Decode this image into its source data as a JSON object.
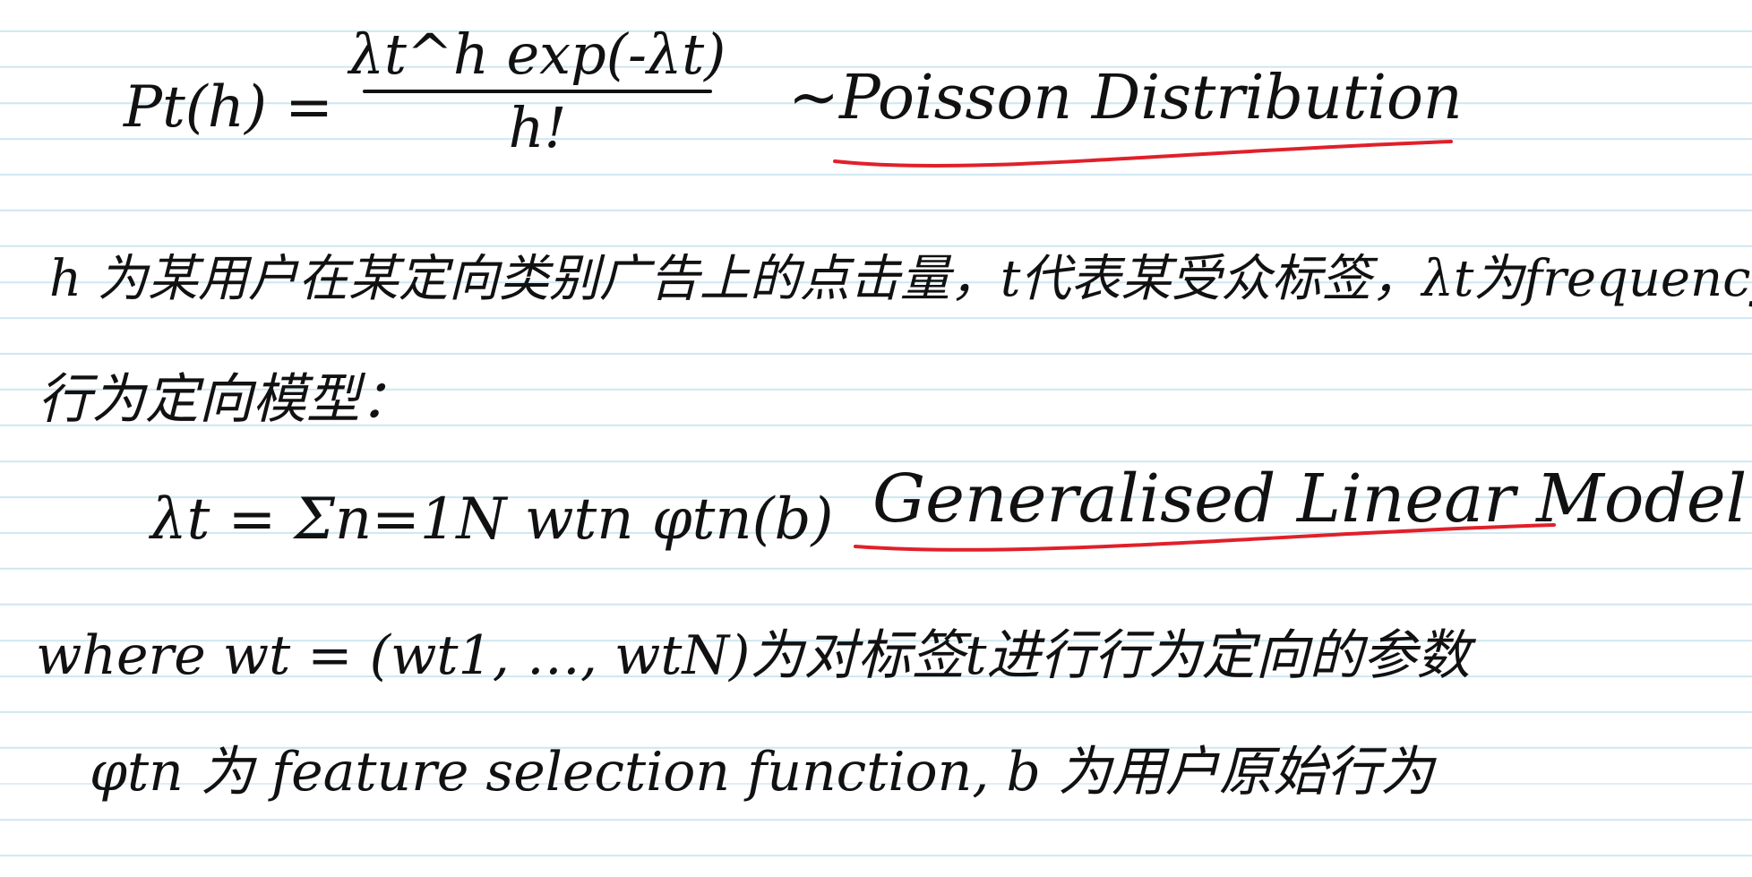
{
  "notes": {
    "poisson": {
      "lhs": "Pt(h) =",
      "numerator": "λt^h exp(-λt)",
      "denominator": "h!",
      "label": "~Poisson Distribution"
    },
    "line1": "h 为某用户在某定向类别广告上的点击量，t代表某受众标签，λt为frequency.",
    "line2": "行为定向模型：",
    "glm": {
      "formula": "λt = Σn=1N wtn φtn(b)",
      "label": "Generalised Linear Model"
    },
    "line3": "where wt = (wt1, …, wtN)为对标签t进行行为定向的参数",
    "line4": "φtn 为 feature selection function, b 为用户原始行为"
  },
  "colors": {
    "ink": "#111111",
    "underline": "#e0202a",
    "rule_line": "#cfe7f2",
    "paper": "#ffffff"
  }
}
